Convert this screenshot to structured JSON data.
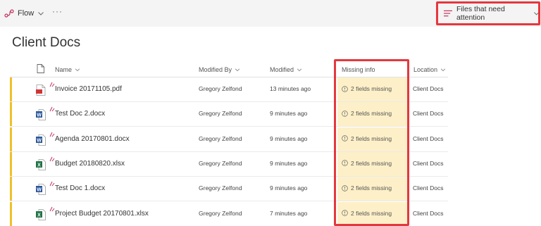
{
  "command_bar": {
    "flow_label": "Flow",
    "more_label": "···",
    "view_label": "Files that need attention"
  },
  "page_title": "Client Docs",
  "columns": {
    "name": "Name",
    "modified_by": "Modified By",
    "modified": "Modified",
    "missing_info": "Missing info",
    "location": "Location"
  },
  "colors": {
    "highlight_box": "#e5373e",
    "attention_bar": "#f0c028",
    "missing_cell_bg": "#fdf0c8",
    "word_blue": "#2b579a",
    "excel_green": "#217346",
    "pdf_red": "#d13438"
  },
  "rows": [
    {
      "name": "Invoice 20171105.pdf",
      "icon": "pdf-icon",
      "modified_by": "Gregory Zelfond",
      "modified": "13 minutes ago",
      "missing": "2 fields missing",
      "location": "Client Docs"
    },
    {
      "name": "Test Doc 2.docx",
      "icon": "word-icon",
      "modified_by": "Gregory Zelfond",
      "modified": "9 minutes ago",
      "missing": "2 fields missing",
      "location": "Client Docs"
    },
    {
      "name": "Agenda 20170801.docx",
      "icon": "word-icon",
      "modified_by": "Gregory Zelfond",
      "modified": "9 minutes ago",
      "missing": "2 fields missing",
      "location": "Client Docs"
    },
    {
      "name": "Budget 20180820.xlsx",
      "icon": "excel-icon",
      "modified_by": "Gregory Zelfond",
      "modified": "9 minutes ago",
      "missing": "2 fields missing",
      "location": "Client Docs"
    },
    {
      "name": "Test Doc 1.docx",
      "icon": "word-icon",
      "modified_by": "Gregory Zelfond",
      "modified": "9 minutes ago",
      "missing": "2 fields missing",
      "location": "Client Docs"
    },
    {
      "name": "Project Budget 20170801.xlsx",
      "icon": "excel-icon",
      "modified_by": "Gregory Zelfond",
      "modified": "7 minutes ago",
      "missing": "2 fields missing",
      "location": "Client Docs"
    }
  ]
}
